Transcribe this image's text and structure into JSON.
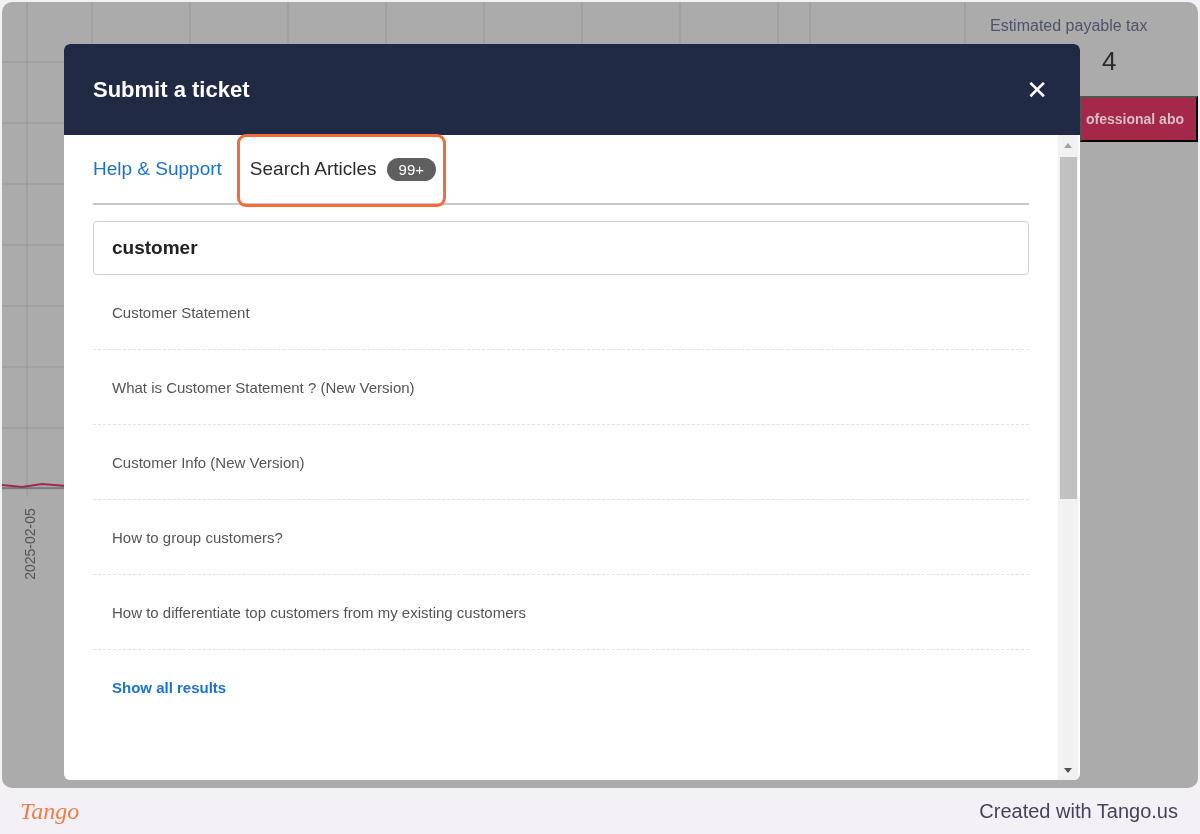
{
  "background": {
    "metric_label": "Estimated payable tax",
    "metric_value": "4",
    "banner_button": "ofessional abo",
    "axis_label": "2025-02-05"
  },
  "modal": {
    "title": "Submit a ticket",
    "close": "✕",
    "tabs": [
      {
        "label": "Help & Support",
        "selected": false,
        "highlighted": false
      },
      {
        "label": "Search Articles",
        "selected": true,
        "highlighted": true,
        "badge": "99+"
      }
    ],
    "search": {
      "value": "customer"
    },
    "results": [
      "Customer Statement",
      "What is Customer Statement ? (New Version)",
      "Customer Info (New Version)",
      "How to group customers?",
      "How to differentiate top customers from my existing customers"
    ],
    "show_all": "Show all results"
  },
  "footer": {
    "logo": "Tango",
    "credit": "Created with Tango.us"
  }
}
